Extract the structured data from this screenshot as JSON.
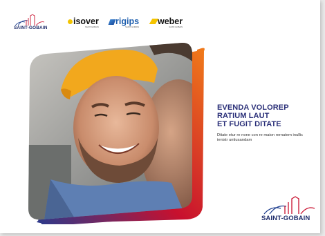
{
  "header": {
    "logos": [
      {
        "name": "SAINT-GOBAIN",
        "sub": ""
      },
      {
        "name": "isover",
        "sub": "SAINT-GOBAIN"
      },
      {
        "name": "rigips",
        "sub": "SAINT-GOBAIN"
      },
      {
        "name": "weber",
        "sub": "SAINT-GOBAIN"
      }
    ]
  },
  "main": {
    "headline_lines": [
      "EVENDA VOLOREP",
      "RATIUM LAUT",
      "ET FUGIT DITATE"
    ],
    "body": "Ditate etur re none con re maion rernatem inullic ienistr untiusandam"
  },
  "footer": {
    "logo_text": "SAINT-GOBAIN"
  },
  "colors": {
    "brand_navy": "#2a2f78",
    "accent_gradient": [
      "#2b3a8c",
      "#c8102e",
      "#f07a1a"
    ],
    "background": "#ffffff"
  }
}
